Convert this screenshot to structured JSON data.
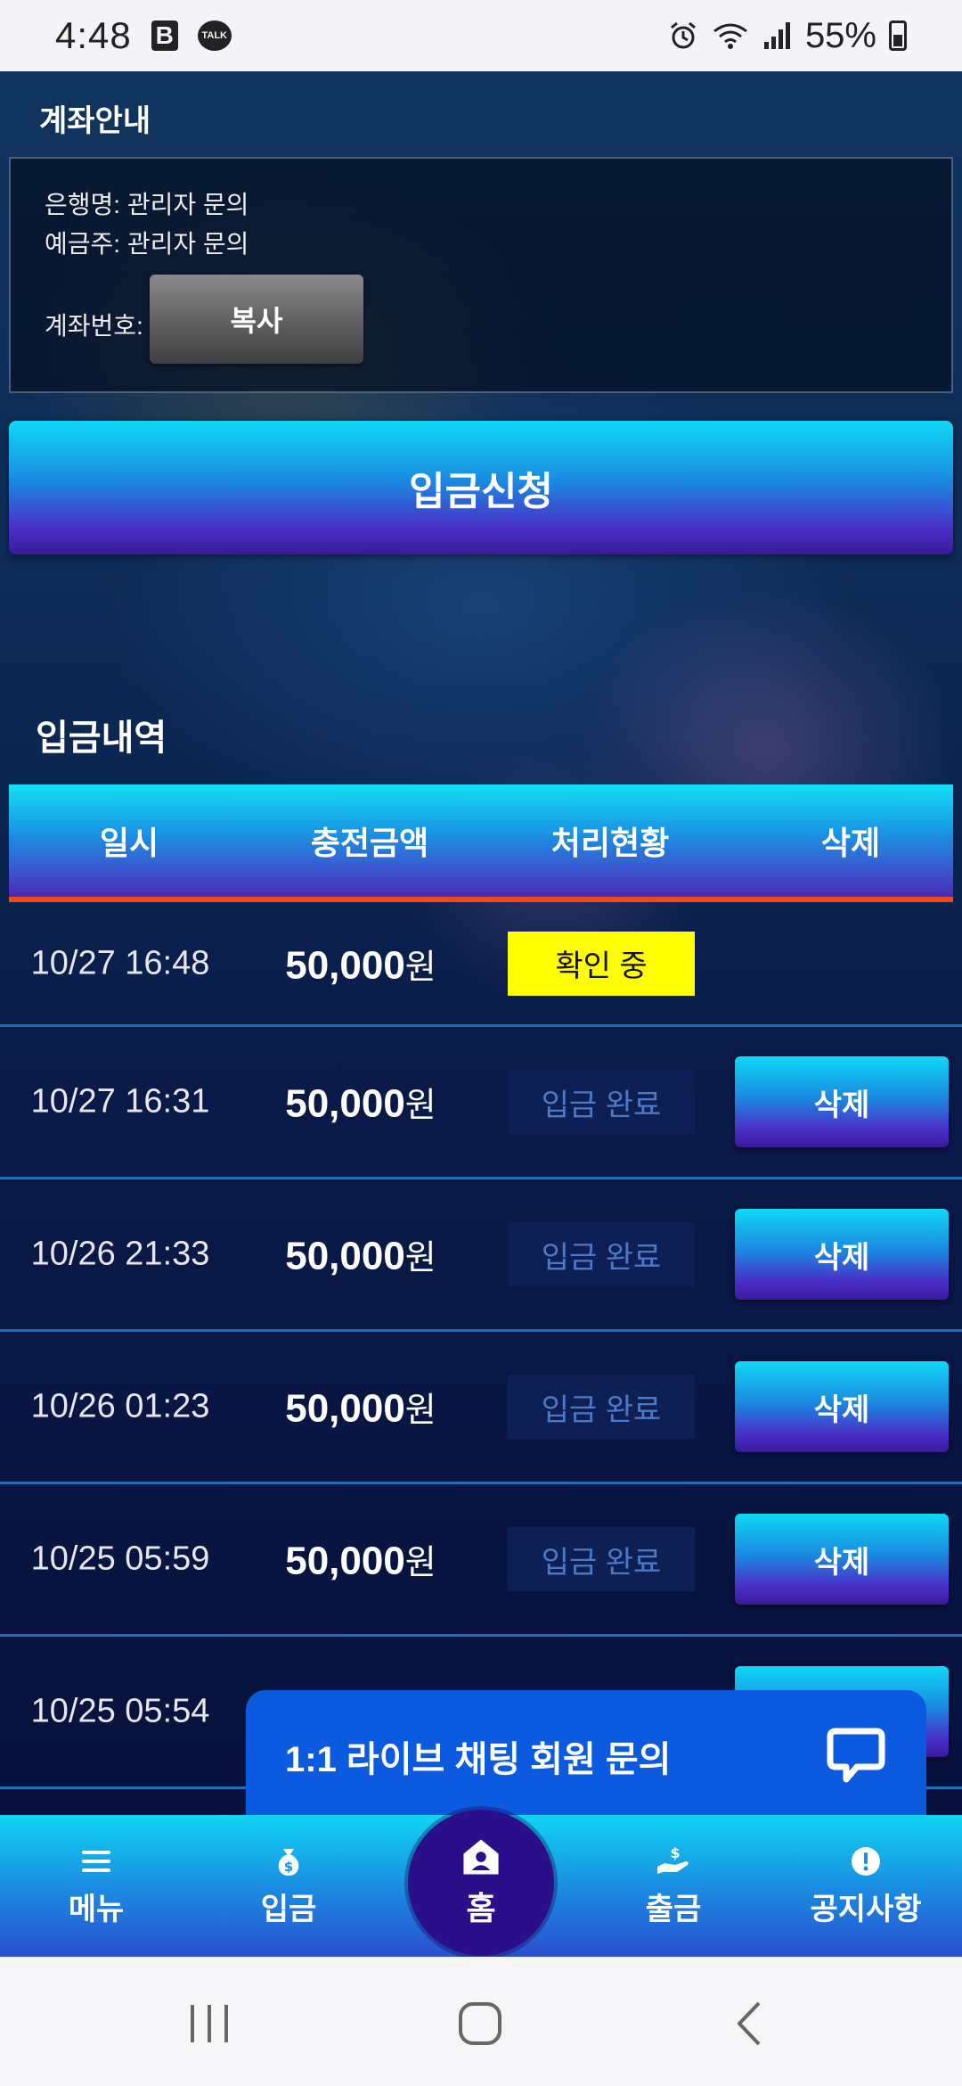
{
  "status_bar": {
    "time": "4:48",
    "battery": "55%",
    "icons": [
      "b-app-icon",
      "kakaotalk-icon",
      "alarm-icon",
      "wifi-icon",
      "signal-icon",
      "battery-icon"
    ],
    "talk_label": "TALK",
    "b_label": "B"
  },
  "account": {
    "title": "계좌안내",
    "bank": "은행명: 관리자 문의",
    "holder": "예금주: 관리자 문의",
    "number_label": "계좌번호:",
    "copy_label": "복사"
  },
  "deposit_request_label": "입금신청",
  "history": {
    "title": "입금내역",
    "columns": [
      "일시",
      "충전금액",
      "처리현황",
      "삭제"
    ],
    "rows": [
      {
        "date": "10/27 16:48",
        "amount": "50,000",
        "unit": "원",
        "status": "확인 중",
        "delete": ""
      },
      {
        "date": "10/27 16:31",
        "amount": "50,000",
        "unit": "원",
        "status": "입금 완료",
        "delete": "삭제"
      },
      {
        "date": "10/26 21:33",
        "amount": "50,000",
        "unit": "원",
        "status": "입금 완료",
        "delete": "삭제"
      },
      {
        "date": "10/26 01:23",
        "amount": "50,000",
        "unit": "원",
        "status": "입금 완료",
        "delete": "삭제"
      },
      {
        "date": "10/25 05:59",
        "amount": "50,000",
        "unit": "원",
        "status": "입금 완료",
        "delete": "삭제"
      },
      {
        "date": "10/25 05:54",
        "amount": "",
        "unit": "",
        "status": "",
        "delete": ""
      }
    ]
  },
  "live_chat": {
    "label": "1:1 라이브 채팅 회원 문의",
    "icon": "chat-bubble-icon"
  },
  "bottom_nav": {
    "menu": "메뉴",
    "deposit": "입금",
    "home": "홈",
    "withdraw": "출금",
    "notice": "공지사항"
  },
  "colors": {
    "accent_cyan": "#10d8f5",
    "accent_purple": "#4a2fc8",
    "header_underline": "#f04a1a",
    "pending_yellow": "#ffff00",
    "chat_blue": "#0b5ae0",
    "home_circle": "#2a0e8a"
  }
}
